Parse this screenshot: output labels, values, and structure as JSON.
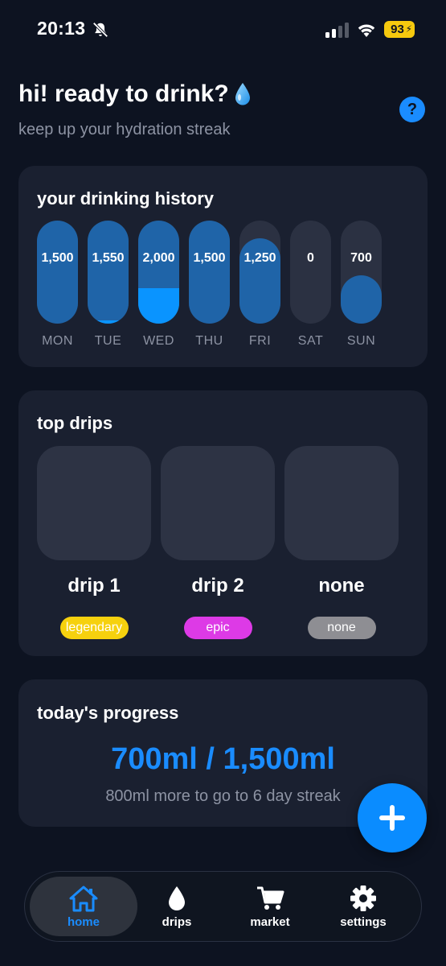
{
  "status_bar": {
    "time": "20:13",
    "battery": "93",
    "icons": [
      "bell-slash-icon",
      "signal-icon",
      "wifi-icon",
      "battery-icon"
    ]
  },
  "header": {
    "greeting": "hi! ready to drink?",
    "subtitle": "keep up your hydration streak",
    "help_label": "?"
  },
  "history": {
    "title": "your drinking history",
    "days": [
      {
        "label": "MON",
        "value": "1,500",
        "fill_pct": 100,
        "extra_pct": 0
      },
      {
        "label": "TUE",
        "value": "1,550",
        "fill_pct": 100,
        "extra_pct": 3
      },
      {
        "label": "WED",
        "value": "2,000",
        "fill_pct": 100,
        "extra_pct": 34
      },
      {
        "label": "THU",
        "value": "1,500",
        "fill_pct": 100,
        "extra_pct": 0
      },
      {
        "label": "FRI",
        "value": "1,250",
        "fill_pct": 83,
        "extra_pct": 0
      },
      {
        "label": "SAT",
        "value": "0",
        "fill_pct": 0,
        "extra_pct": 0
      },
      {
        "label": "SUN",
        "value": "700",
        "fill_pct": 47,
        "extra_pct": 0
      }
    ]
  },
  "top_drips": {
    "title": "top drips",
    "items": [
      {
        "name": "drip 1",
        "rarity": "legendary",
        "rarity_bg": "#f6d10e",
        "rarity_fg": "#ffffff"
      },
      {
        "name": "drip 2",
        "rarity": "epic",
        "rarity_bg": "#dd3ae6",
        "rarity_fg": "#ffffff"
      },
      {
        "name": "none",
        "rarity": "none",
        "rarity_bg": "#8e8e93",
        "rarity_fg": "#ffffff"
      }
    ]
  },
  "progress": {
    "title": "today's progress",
    "amount": "700ml / 1,500ml",
    "remaining": "800ml more to go to 6 day streak"
  },
  "tabs": [
    {
      "label": "home",
      "icon": "home-icon",
      "active": true
    },
    {
      "label": "drips",
      "icon": "drop-icon",
      "active": false
    },
    {
      "label": "market",
      "icon": "cart-icon",
      "active": false
    },
    {
      "label": "settings",
      "icon": "gear-icon",
      "active": false
    }
  ],
  "colors": {
    "background": "#0d1321",
    "card": "#1a2030",
    "accent": "#1a8cff",
    "bar_fill": "#1f64a8",
    "bar_extra": "#0a94ff"
  }
}
